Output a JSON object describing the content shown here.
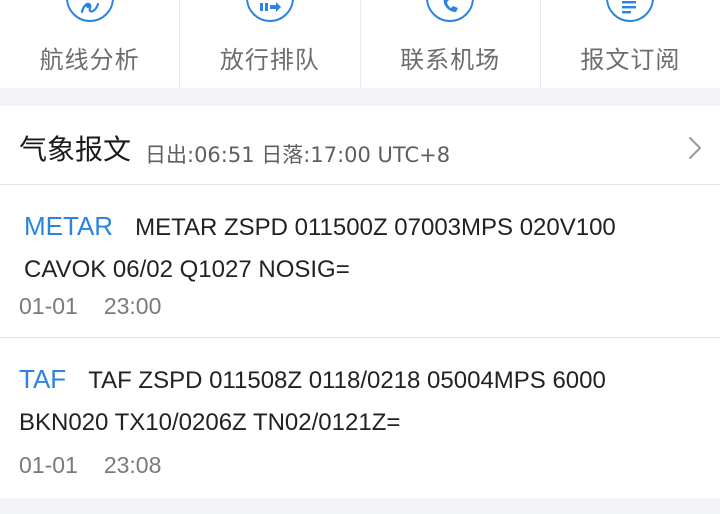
{
  "toolbar": {
    "items": [
      {
        "label": "航线分析",
        "icon": "route-analysis-icon"
      },
      {
        "label": "放行排队",
        "icon": "queue-arrow-icon"
      },
      {
        "label": "联系机场",
        "icon": "phone-icon"
      },
      {
        "label": "报文订阅",
        "icon": "document-icon"
      }
    ]
  },
  "weather": {
    "title": "气象报文",
    "sun_info": "日出:06:51 日落:17:00 UTC+8",
    "reports": [
      {
        "type": "METAR",
        "text": "METAR ZSPD 011500Z 07003MPS 020V100 CAVOK 06/02 Q1027 NOSIG=",
        "date": "01-01",
        "time": "23:00"
      },
      {
        "type": "TAF",
        "text": "TAF ZSPD 011508Z 0118/0218 05004MPS 6000 BKN020 TX10/0206Z TN02/0121Z=",
        "date": "01-01",
        "time": "23:08"
      }
    ]
  },
  "colors": {
    "accent": "#2c84e0",
    "background": "#f2f4f7"
  }
}
